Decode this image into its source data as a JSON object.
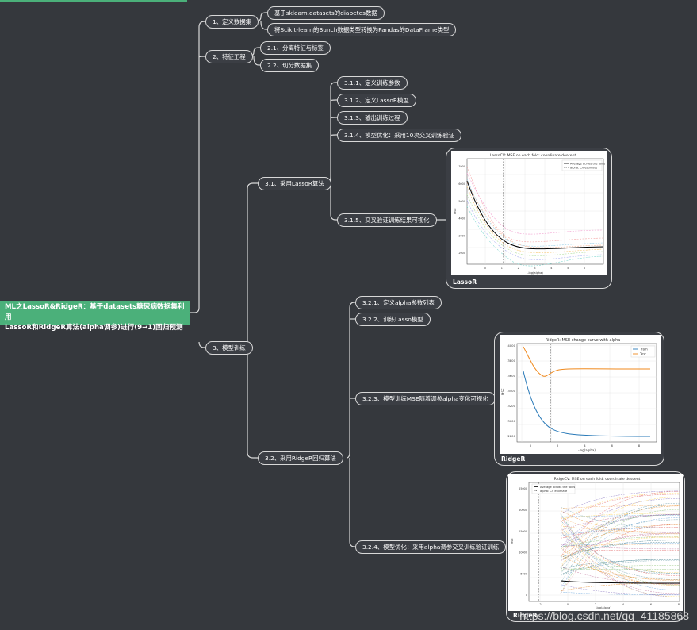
{
  "root": {
    "line1": "ML之LassoR&RidgeR：基于datasets糖尿病数据集利用",
    "line2": "LassoR和RidgeR算法(alpha调参)进行(9→1)回归预测"
  },
  "nodes": {
    "n1": "1、定义数据集",
    "n1a": "基于sklearn.datasets的diabetes数据",
    "n1b": "将Scikit-learn的Bunch数据类型转换为Pandas的DataFrame类型",
    "n2": "2、特征工程",
    "n21": "2.1、分离特征与标签",
    "n22": "2.2、切分数据集",
    "n3": "3、模型训练",
    "n31": "3.1、采用LassoR算法",
    "n311": "3.1.1、定义训练参数",
    "n312": "3.1.2、定义LassoR模型",
    "n313": "3.1.3、输出训练过程",
    "n314": "3.1.4、模型优化：采用10次交叉训练验证",
    "n315": "3.1.5、交叉验证训练结果可视化",
    "n32": "3.2、采用RidgeR回归算法",
    "n321": "3.2.1、定义alpha参数列表",
    "n322": "3.2.2、训练Lasso模型",
    "n323": "3.2.3、模型训练MSE随着调参alpha变化可视化",
    "n324": "3.2.4、模型优化：采用alpha调参交叉训练验证训练"
  },
  "cards": {
    "lasso": {
      "caption": "LassoR",
      "title": "LassoCV: MSE on each fold: coordinate descent",
      "legend": [
        "Average across the folds",
        "alpha: CV estimate"
      ],
      "ylabel": "MSE",
      "xlabel": "-log(alpha)",
      "xticks": [
        "0",
        "1",
        "2",
        "3",
        "4",
        "5",
        "6"
      ],
      "yticks": [
        "7000",
        "6000",
        "5000",
        "4000",
        "3000",
        "2000"
      ]
    },
    "ridge1": {
      "caption": "RidgeR",
      "title": "RidgeR: MSE change curve with alpha",
      "legend": [
        "Train",
        "Test"
      ],
      "ylabel": "MSE",
      "xlabel": "-log(alpha)",
      "xticks": [
        "0",
        "2",
        "4",
        "6",
        "8"
      ],
      "yticks": [
        "4000",
        "3800",
        "3600",
        "3400",
        "3200",
        "3000",
        "2800"
      ]
    },
    "ridge2": {
      "caption": "RidgeR",
      "title": "RidgeCV: MSE on each fold: coordinate descent",
      "legend": [
        "Average across the folds",
        "alpha: CV estimate"
      ],
      "ylabel": "MSE",
      "xlabel": "-log(alpha)",
      "xticks": [
        "-2",
        "0",
        "2",
        "4",
        "6",
        "8"
      ],
      "yticks": [
        "25000",
        "20000",
        "15000",
        "10000",
        "5000",
        "0"
      ]
    }
  },
  "watermark": "https://blog.csdn.net/qq_41185868",
  "colors": {
    "background": "#35383d",
    "root": "#4bb07a",
    "line": "#d8d8d8"
  }
}
